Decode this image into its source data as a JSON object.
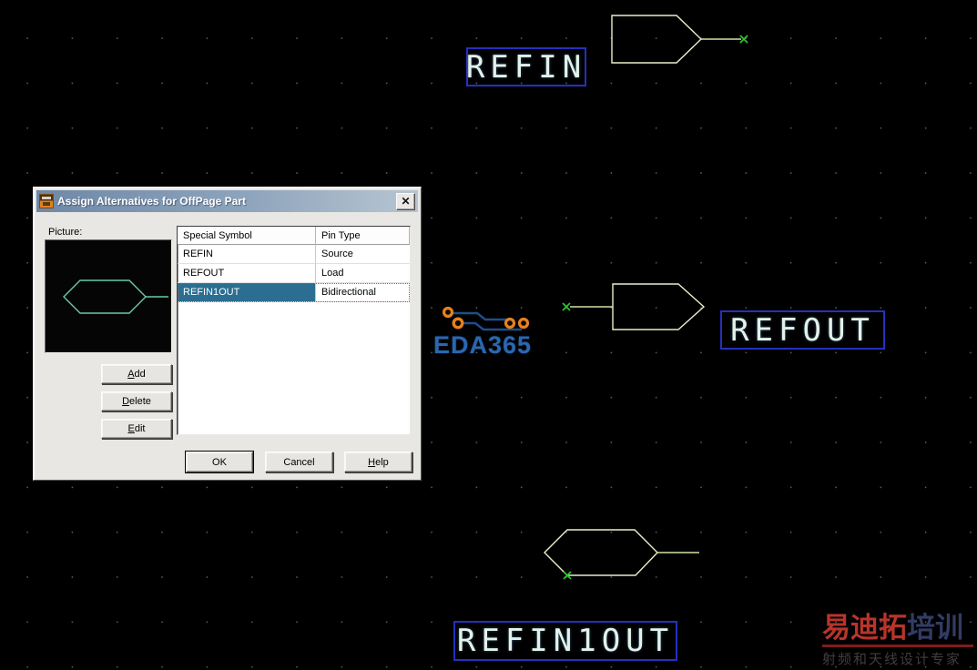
{
  "dialog": {
    "title": "Assign Alternatives for OffPage Part",
    "picture_label": "Picture:",
    "table": {
      "columns": [
        "Special Symbol",
        "Pin Type"
      ],
      "rows": [
        {
          "symbol": "REFIN",
          "pin_type": "Source"
        },
        {
          "symbol": "REFOUT",
          "pin_type": "Load"
        },
        {
          "symbol": "REFIN1OUT",
          "pin_type": "Bidirectional"
        }
      ],
      "selected_row": "REFIN1OUT",
      "selection_color": "#2b6e91"
    },
    "buttons": {
      "add": "Add",
      "delete": "Delete",
      "edit": "Edit",
      "ok": "OK",
      "cancel": "Cancel",
      "help": "Help"
    },
    "icons": {
      "close": "✕"
    }
  },
  "schematic": {
    "labels": {
      "refin": "REFIN",
      "refout": "REFOUT",
      "refin1out": "REFIN1OUT"
    },
    "colors": {
      "symbol_outline": "#e7eecb",
      "wire": "#cfe3a2",
      "pin_x": "#2fc42f",
      "label_box": "#2531bd",
      "label_text": "#e3f2e8",
      "preview_symbol": "#66cba2"
    }
  },
  "watermarks": {
    "eda365_text": "EDA365",
    "training_line1_red": "易迪拓",
    "training_line1_blue": "培训",
    "training_line2": "射频和天线设计专家"
  }
}
